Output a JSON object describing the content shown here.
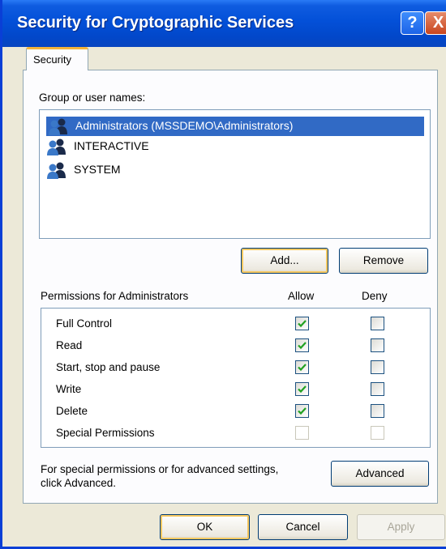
{
  "window": {
    "title": "Security for Cryptographic Services",
    "help": "?",
    "close": "X"
  },
  "tabs": [
    {
      "label": "Security",
      "active": true
    }
  ],
  "users": {
    "label": "Group or user names:",
    "items": [
      {
        "name": "Administrators (MSSDEMO\\Administrators)",
        "selected": true
      },
      {
        "name": "INTERACTIVE",
        "selected": false
      },
      {
        "name": "SYSTEM",
        "selected": false
      }
    ],
    "add_label": "Add...",
    "remove_label": "Remove"
  },
  "permissions": {
    "label": "Permissions for Administrators",
    "allow_header": "Allow",
    "deny_header": "Deny",
    "rows": [
      {
        "name": "Full Control",
        "allow": true,
        "deny": false,
        "enabled": true
      },
      {
        "name": "Read",
        "allow": true,
        "deny": false,
        "enabled": true
      },
      {
        "name": "Start, stop and pause",
        "allow": true,
        "deny": false,
        "enabled": true
      },
      {
        "name": "Write",
        "allow": true,
        "deny": false,
        "enabled": true
      },
      {
        "name": "Delete",
        "allow": true,
        "deny": false,
        "enabled": true
      },
      {
        "name": "Special Permissions",
        "allow": false,
        "deny": false,
        "enabled": false
      }
    ]
  },
  "advanced": {
    "text_line1": "For special permissions or for advanced settings,",
    "text_line2": "click Advanced.",
    "button_label": "Advanced"
  },
  "footer": {
    "ok_label": "OK",
    "cancel_label": "Cancel",
    "apply_label": "Apply"
  },
  "colors": {
    "title_bar": "#0350d8",
    "selection": "#316ac5",
    "dialog_bg": "#ece9d8",
    "check": "#21a121"
  },
  "icons": {
    "user_group": "users-group-icon",
    "check": "check-icon"
  }
}
